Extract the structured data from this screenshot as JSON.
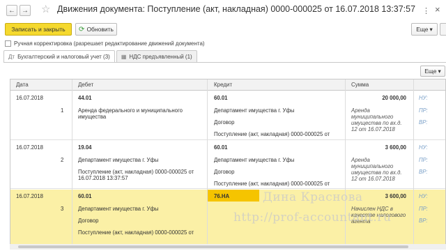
{
  "window": {
    "title": "Движения документа: Поступление (акт, накладная) 0000-000025 от 16.07.2018 13:37:57",
    "more_glyph": "⋮",
    "close_glyph": "×",
    "back_glyph": "←",
    "forward_glyph": "→",
    "star_glyph": "☆"
  },
  "toolbar": {
    "save_close_label": "Записать и закрыть",
    "refresh_label": "Обновить",
    "refresh_icon": "refresh-icon",
    "more_label": "Еще",
    "dropdown_glyph": "▾"
  },
  "manual_adjust": {
    "label": "Ручная корректировка (разрешает редактирование движений документа)",
    "checked": false
  },
  "tabs": [
    {
      "label": "Бухгалтерский и налоговый учет (3)",
      "active": true
    },
    {
      "label": "НДС предъявленный (1)",
      "active": false
    }
  ],
  "table": {
    "more_label": "Еще",
    "columns": {
      "date": "Дата",
      "debit": "Дебет",
      "credit": "Кредит",
      "amount": "Сумма"
    },
    "rows": [
      {
        "date": "16.07.2018",
        "num": "1",
        "debit_account": "44.01",
        "debit_sub1": "Аренда федерального и муниципального имущества",
        "credit_account": "60.01",
        "credit_sub1": "Департамент имущества г. Уфы",
        "credit_sub2": "Договор",
        "credit_sub3": "Поступление (акт, накладная) 0000-000025 от",
        "amount": "20 000,00",
        "content": "Аренда муниципального имущества по вх.д. 12 от 16.07.2018",
        "tags": [
          "НУ:",
          "ПР:",
          "ВР:"
        ]
      },
      {
        "date": "16.07.2018",
        "num": "2",
        "debit_account": "19.04",
        "debit_sub1": "Департамент имущества г. Уфы",
        "debit_sub2": "Поступление (акт, накладная) 0000-000025 от 16.07.2018 13:37:57",
        "credit_account": "60.01",
        "credit_sub1": "Департамент имущества г. Уфы",
        "credit_sub2": "Договор",
        "credit_sub3": "Поступление (акт, накладная) 0000-000025 от",
        "amount": "3 600,00",
        "content": "Аренда муниципального имущества по вх.д. 12 от 16.07.2018",
        "tags": [
          "НУ:",
          "ПР:",
          "ВР:"
        ]
      },
      {
        "date": "16.07.2018",
        "num": "3",
        "debit_account": "60.01",
        "debit_sub1": "Департамент имущества г. Уфы",
        "debit_sub2": "Договор",
        "debit_sub3": "Поступление (акт, накладная) 0000-000025 от",
        "credit_account": "76.НА",
        "amount": "3 600,00",
        "content": "Начислен НДС в качестве налогового агента",
        "tags": [
          "НУ:",
          "ПР:",
          "ВР:"
        ]
      }
    ]
  },
  "watermark": {
    "name": "Дина Краснова",
    "url": "http://prof-accountant.ru"
  }
}
